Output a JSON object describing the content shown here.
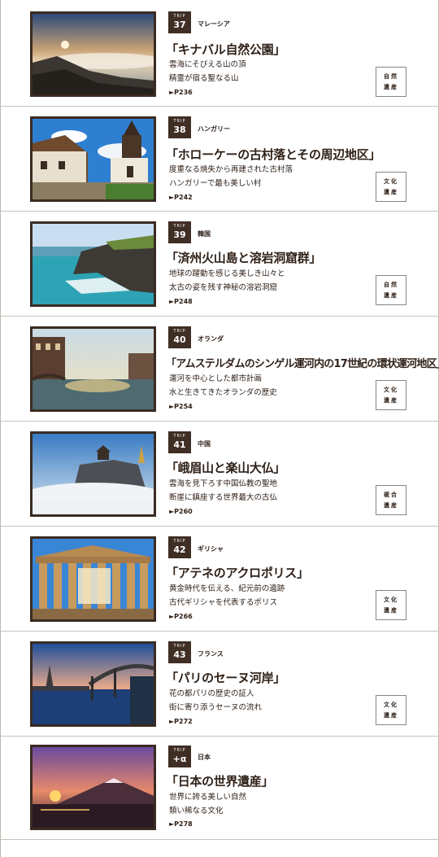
{
  "entries": [
    {
      "badge_label": "TRIP",
      "number": "37",
      "country": "マレーシア",
      "title": "「キナバル自然公園」",
      "desc": [
        "雲海にそびえる山の頂",
        "精霊が宿る聖なる山"
      ],
      "page": "►P236",
      "category": [
        "自然",
        "遺産"
      ],
      "scene": "mountain"
    },
    {
      "badge_label": "TRIP",
      "number": "38",
      "country": "ハンガリー",
      "title": "「ホローケーの古村落とその周辺地区」",
      "desc": [
        "度重なる焼失から再建された古村落",
        "ハンガリーで最も美しい村"
      ],
      "page": "►P242",
      "category": [
        "文化",
        "遺産"
      ],
      "scene": "village"
    },
    {
      "badge_label": "TRIP",
      "number": "39",
      "country": "韓国",
      "title": "「済州火山島と溶岩洞窟群」",
      "desc": [
        "地球の躍動を感じる美しき山々と",
        "太古の姿を残す神秘の溶岩洞窟"
      ],
      "page": "►P248",
      "category": [
        "自然",
        "遺産"
      ],
      "scene": "coast"
    },
    {
      "badge_label": "TRIP",
      "number": "40",
      "country": "オランダ",
      "title": "「アムステルダムのシンゲル運河内の17世紀の環状運河地区」",
      "desc": [
        "運河を中心とした都市計画",
        "水と生きてきたオランダの歴史"
      ],
      "page": "►P254",
      "category": [
        "文化",
        "遺産"
      ],
      "scene": "canal"
    },
    {
      "badge_label": "TRIP",
      "number": "41",
      "country": "中国",
      "title": "「峨眉山と楽山大仏」",
      "desc": [
        "雲海を見下ろす中国仏教の聖地",
        "断崖に鎮座する世界最大の古仏"
      ],
      "page": "►P260",
      "category": [
        "複合",
        "遺産"
      ],
      "scene": "cliff"
    },
    {
      "badge_label": "TRIP",
      "number": "42",
      "country": "ギリシャ",
      "title": "「アテネのアクロポリス」",
      "desc": [
        "黄金時代を伝える、紀元前の遺跡",
        "古代ギリシャを代表するポリス"
      ],
      "page": "►P266",
      "category": [
        "文化",
        "遺産"
      ],
      "scene": "temple"
    },
    {
      "badge_label": "TRIP",
      "number": "43",
      "country": "フランス",
      "title": "「パリのセーヌ河岸」",
      "desc": [
        "花の都パリの歴史の証人",
        "街に寄り添うセーヌの流れ"
      ],
      "page": "►P272",
      "category": [
        "文化",
        "遺産"
      ],
      "scene": "paris"
    },
    {
      "badge_label": "TRIP",
      "number": "+α",
      "country": "日本",
      "title": "「日本の世界遺産」",
      "desc": [
        "世界に誇る美しい自然",
        "類い稀なる文化"
      ],
      "page": "►P278",
      "category": [],
      "scene": "fuji"
    }
  ]
}
